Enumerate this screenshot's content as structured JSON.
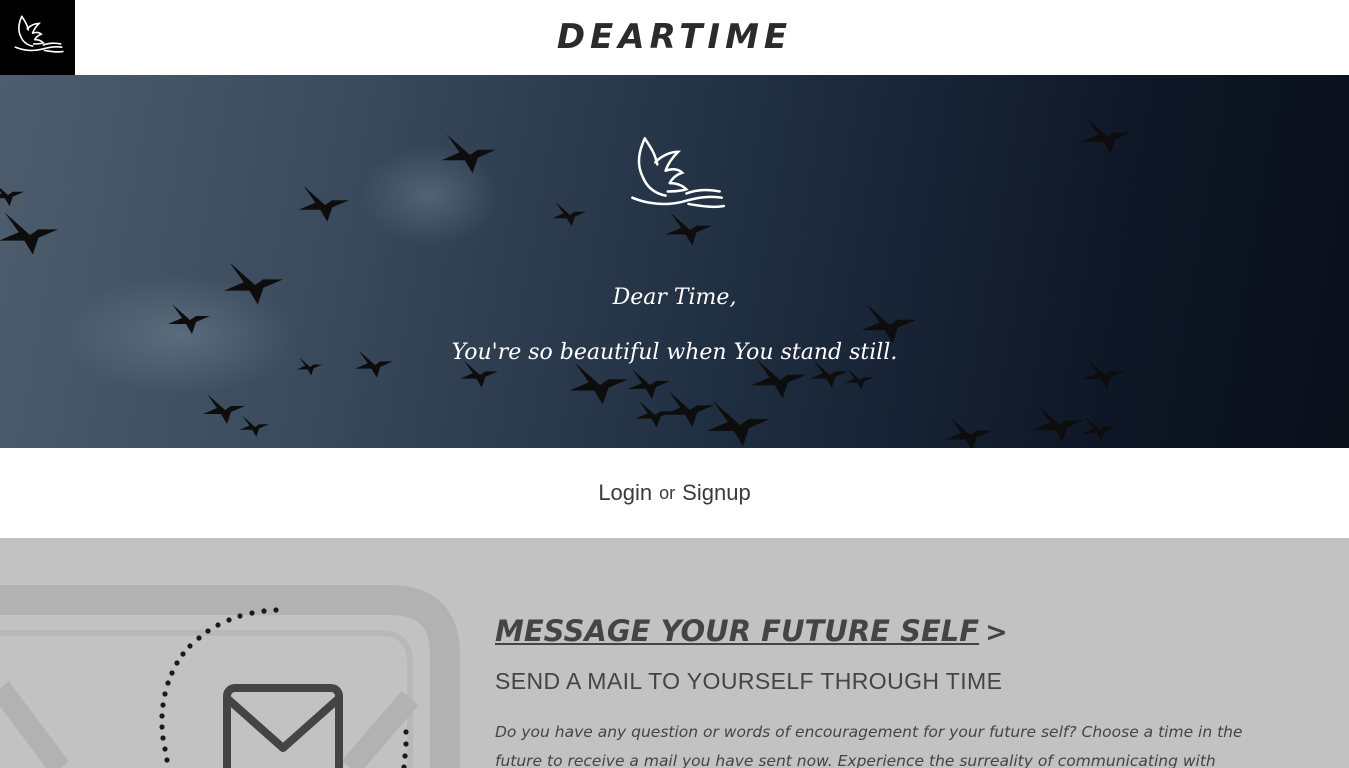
{
  "header": {
    "title": "DEARTIME",
    "logo_icon": "dove-icon",
    "logo_background": "#000000"
  },
  "hero": {
    "logo_icon": "dove-icon",
    "line1": "Dear Time,",
    "line2": "You're so beautiful when You stand still.",
    "background_image": "birds-flying-in-dusk-sky"
  },
  "auth": {
    "login_label": "Login",
    "or_label": "or",
    "signup_label": "Signup"
  },
  "feature": {
    "title": "MESSAGE YOUR FUTURE SELF",
    "arrow": ">",
    "subtitle": "SEND A MAIL TO YOURSELF THROUGH TIME",
    "description": "Do you have any question or words of encouragement for your future self? Choose a time in the future to receive a mail you have sent now. Experience the surreality of communicating with yourself across",
    "illustration_icon": "envelope-icon",
    "background_color": "#c2c2c2"
  }
}
